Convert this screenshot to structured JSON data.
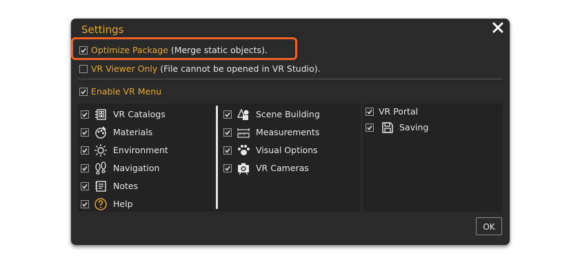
{
  "dialog": {
    "title": "Settings",
    "close_icon": "close-icon",
    "ok_label": "OK"
  },
  "options": {
    "optimize": {
      "label": "Optimize Package",
      "note": "(Merge static objects).",
      "checked": true
    },
    "viewer_only": {
      "label": "VR Viewer Only",
      "note": "(File cannot be opened in VR Studio).",
      "checked": false
    },
    "enable_menu": {
      "label": "Enable VR Menu",
      "checked": true
    }
  },
  "menu": {
    "col1": [
      {
        "label": "VR Catalogs",
        "icon": "catalog-icon",
        "checked": true
      },
      {
        "label": "Materials",
        "icon": "materials-icon",
        "checked": true
      },
      {
        "label": "Environment",
        "icon": "sun-icon",
        "checked": true
      },
      {
        "label": "Navigation",
        "icon": "footprints-icon",
        "checked": true
      },
      {
        "label": "Notes",
        "icon": "notes-icon",
        "checked": true
      },
      {
        "label": "Help",
        "icon": "help-icon",
        "checked": true
      }
    ],
    "col2": [
      {
        "label": "Scene Building",
        "icon": "shapes-icon",
        "checked": true
      },
      {
        "label": "Measurements",
        "icon": "ruler-icon",
        "checked": true
      },
      {
        "label": "Visual Options",
        "icon": "paw-icon",
        "checked": true
      },
      {
        "label": "VR Cameras",
        "icon": "camera-icon",
        "checked": true
      }
    ],
    "col3": [
      {
        "label": "VR Portal",
        "checked": true
      },
      {
        "label": "Saving",
        "icon": "save-icon",
        "checked": true
      }
    ]
  },
  "colors": {
    "accent": "#e3a82a",
    "highlight": "#f0612a",
    "background": "#2a2a2a"
  }
}
